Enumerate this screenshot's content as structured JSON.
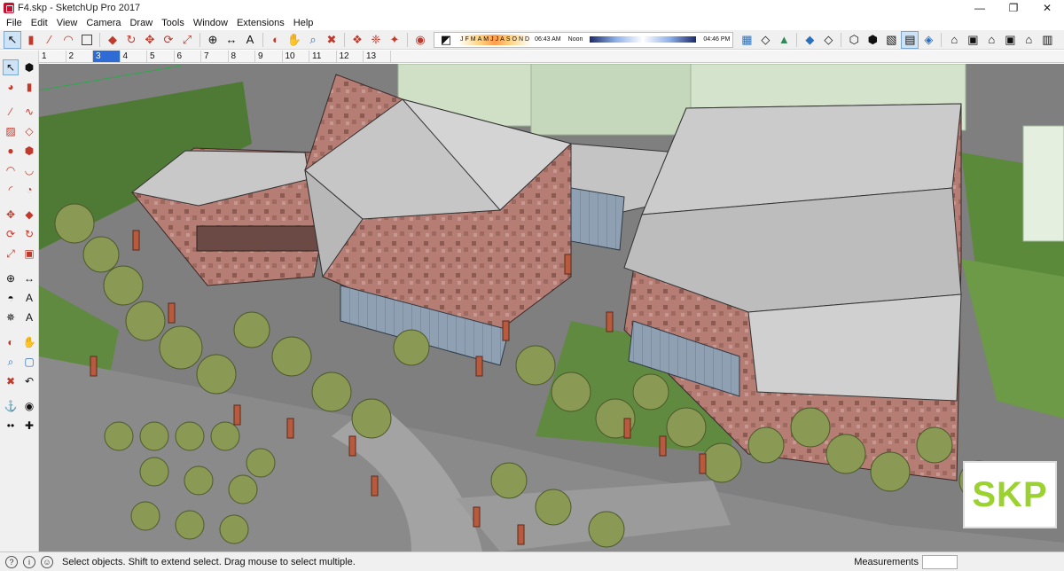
{
  "window": {
    "title": "F4.skp - SketchUp Pro 2017",
    "minimize": "—",
    "maximize": "❐",
    "close": "✕"
  },
  "menu": {
    "items": [
      "File",
      "Edit",
      "View",
      "Camera",
      "Draw",
      "Tools",
      "Window",
      "Extensions",
      "Help"
    ]
  },
  "shadows": {
    "months": [
      "J",
      "F",
      "M",
      "A",
      "M",
      "J",
      "J",
      "A",
      "S",
      "O",
      "N",
      "D"
    ],
    "time_start": "06:43 AM",
    "time_mid": "Noon",
    "time_end": "04:46 PM"
  },
  "scenes": {
    "tabs": [
      "1",
      "2",
      "3",
      "4",
      "5",
      "6",
      "7",
      "8",
      "9",
      "10",
      "11",
      "12",
      "13"
    ],
    "active_index": 2
  },
  "status": {
    "message": "Select objects. Shift to extend select. Drag mouse to select multiple.",
    "measurements_label": "Measurements",
    "measurements_value": ""
  },
  "watermark": {
    "text": "SKP",
    "color": "#9bd232"
  },
  "colors": {
    "facade": "#b07a72",
    "roof": "#bcbcbc",
    "grass": "#5f8a3f",
    "road": "#8c8c8c",
    "selection_blue": "#2f6bd4"
  }
}
